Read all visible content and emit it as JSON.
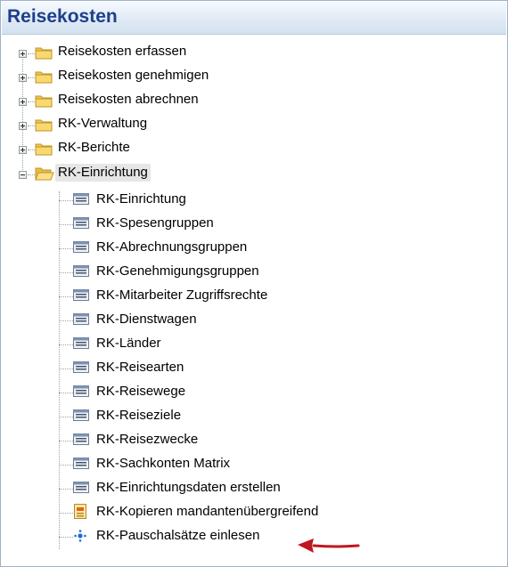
{
  "window": {
    "title": "Reisekosten"
  },
  "tree": {
    "top_items": [
      {
        "label": "Reisekosten erfassen",
        "icon": "folder-icon",
        "expanded": false
      },
      {
        "label": "Reisekosten genehmigen",
        "icon": "folder-icon",
        "expanded": false
      },
      {
        "label": "Reisekosten abrechnen",
        "icon": "folder-icon",
        "expanded": false
      },
      {
        "label": "RK-Verwaltung",
        "icon": "folder-icon",
        "expanded": false
      },
      {
        "label": "RK-Berichte",
        "icon": "folder-icon",
        "expanded": false
      },
      {
        "label": "RK-Einrichtung",
        "icon": "open-folder-icon",
        "expanded": true,
        "selected": true
      }
    ],
    "children": [
      {
        "label": "RK-Einrichtung",
        "icon": "form-icon"
      },
      {
        "label": "RK-Spesengruppen",
        "icon": "form-icon"
      },
      {
        "label": "RK-Abrechnungsgruppen",
        "icon": "form-icon"
      },
      {
        "label": "RK-Genehmigungsgruppen",
        "icon": "form-icon"
      },
      {
        "label": "RK-Mitarbeiter Zugriffsrechte",
        "icon": "form-icon"
      },
      {
        "label": "RK-Dienstwagen",
        "icon": "form-icon"
      },
      {
        "label": "RK-Länder",
        "icon": "form-icon"
      },
      {
        "label": "RK-Reisearten",
        "icon": "form-icon"
      },
      {
        "label": "RK-Reisewege",
        "icon": "form-icon"
      },
      {
        "label": "RK-Reiseziele",
        "icon": "form-icon"
      },
      {
        "label": "RK-Reisezwecke",
        "icon": "form-icon"
      },
      {
        "label": "RK-Sachkonten Matrix",
        "icon": "form-icon"
      },
      {
        "label": "RK-Einrichtungsdaten erstellen",
        "icon": "form-icon"
      },
      {
        "label": "RK-Kopieren mandantenübergreifend",
        "icon": "report-icon"
      },
      {
        "label": "RK-Pauschalsätze einlesen",
        "icon": "codeunit-icon"
      }
    ]
  },
  "annotation": {
    "arrow_color": "#c0161d",
    "icon": "red-arrow-icon"
  }
}
